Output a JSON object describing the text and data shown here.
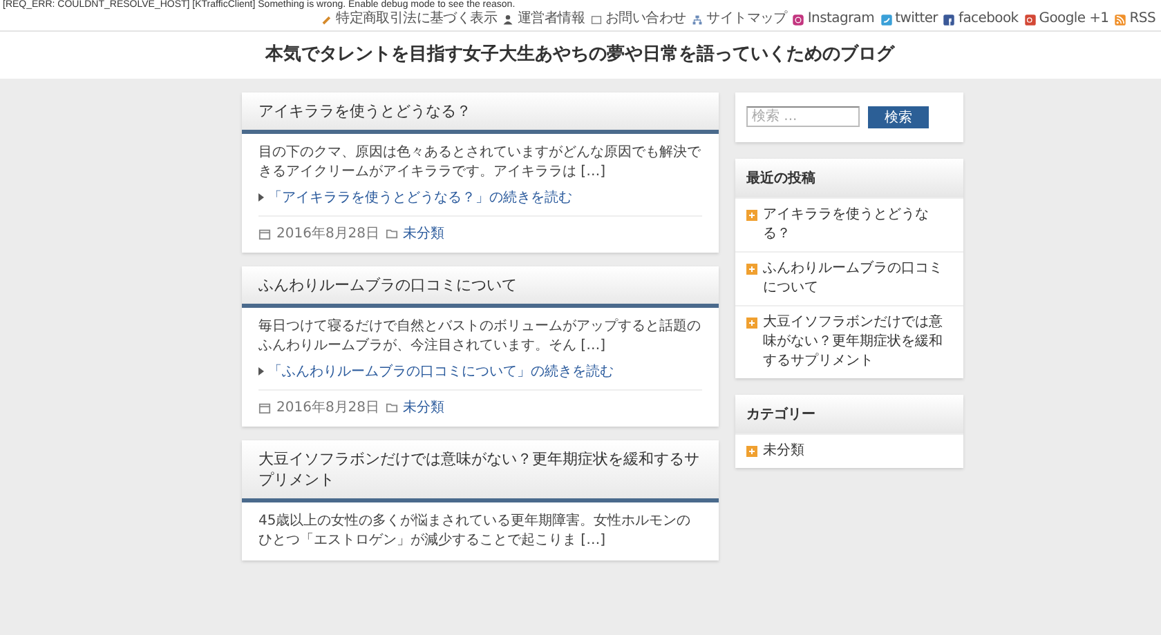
{
  "top_bar": {
    "error": "[REQ_ERR: COULDNT_RESOLVE_HOST] [KTrafficClient] Something is wrong. Enable debug mode to see the reason.",
    "links": [
      {
        "label": "特定商取引法に基づく表示"
      },
      {
        "label": "運営者情報"
      },
      {
        "label": "お問い合わせ"
      },
      {
        "label": "サイトマップ"
      },
      {
        "label": "Instagram"
      },
      {
        "label": "twitter"
      },
      {
        "label": "facebook"
      },
      {
        "label": "Google +1"
      },
      {
        "label": "RSS"
      }
    ]
  },
  "header": {
    "site_title": "本気でタレントを目指す女子大生あやちの夢や日常を語っていくためのブログ"
  },
  "posts": [
    {
      "title": "アイキララを使うとどうなる？",
      "excerpt": "目の下のクマ、原因は色々あるとされていますがどんな原因でも解決できるアイクリームがアイキララです。アイキララは […]",
      "more_link": "「アイキララを使うとどうなる？」の続きを読む",
      "date": "2016年8月28日",
      "category": "未分類"
    },
    {
      "title": "ふんわりルームブラの口コミについて",
      "excerpt": "毎日つけて寝るだけで自然とバストのボリュームがアップすると話題のふんわりルームブラが、今注目されています。そん […]",
      "more_link": "「ふんわりルームブラの口コミについて」の続きを読む",
      "date": "2016年8月28日",
      "category": "未分類"
    },
    {
      "title": "大豆イソフラボンだけでは意味がない？更年期症状を緩和するサプリメント",
      "excerpt": "45歳以上の女性の多くが悩まされている更年期障害。女性ホルモンのひとつ「エストロゲン」が減少することで起こりま […]"
    }
  ],
  "sidebar": {
    "search": {
      "placeholder": "検索 ...",
      "button": "検索"
    },
    "widgets": [
      {
        "title": "最近の投稿",
        "items": [
          "アイキララを使うとどうなる？",
          "ふんわりルームブラの口コミについて",
          "大豆イソフラボンだけでは意味がない？更年期症状を緩和するサプリメント"
        ]
      },
      {
        "title": "カテゴリー",
        "items": [
          "未分類"
        ]
      }
    ]
  }
}
